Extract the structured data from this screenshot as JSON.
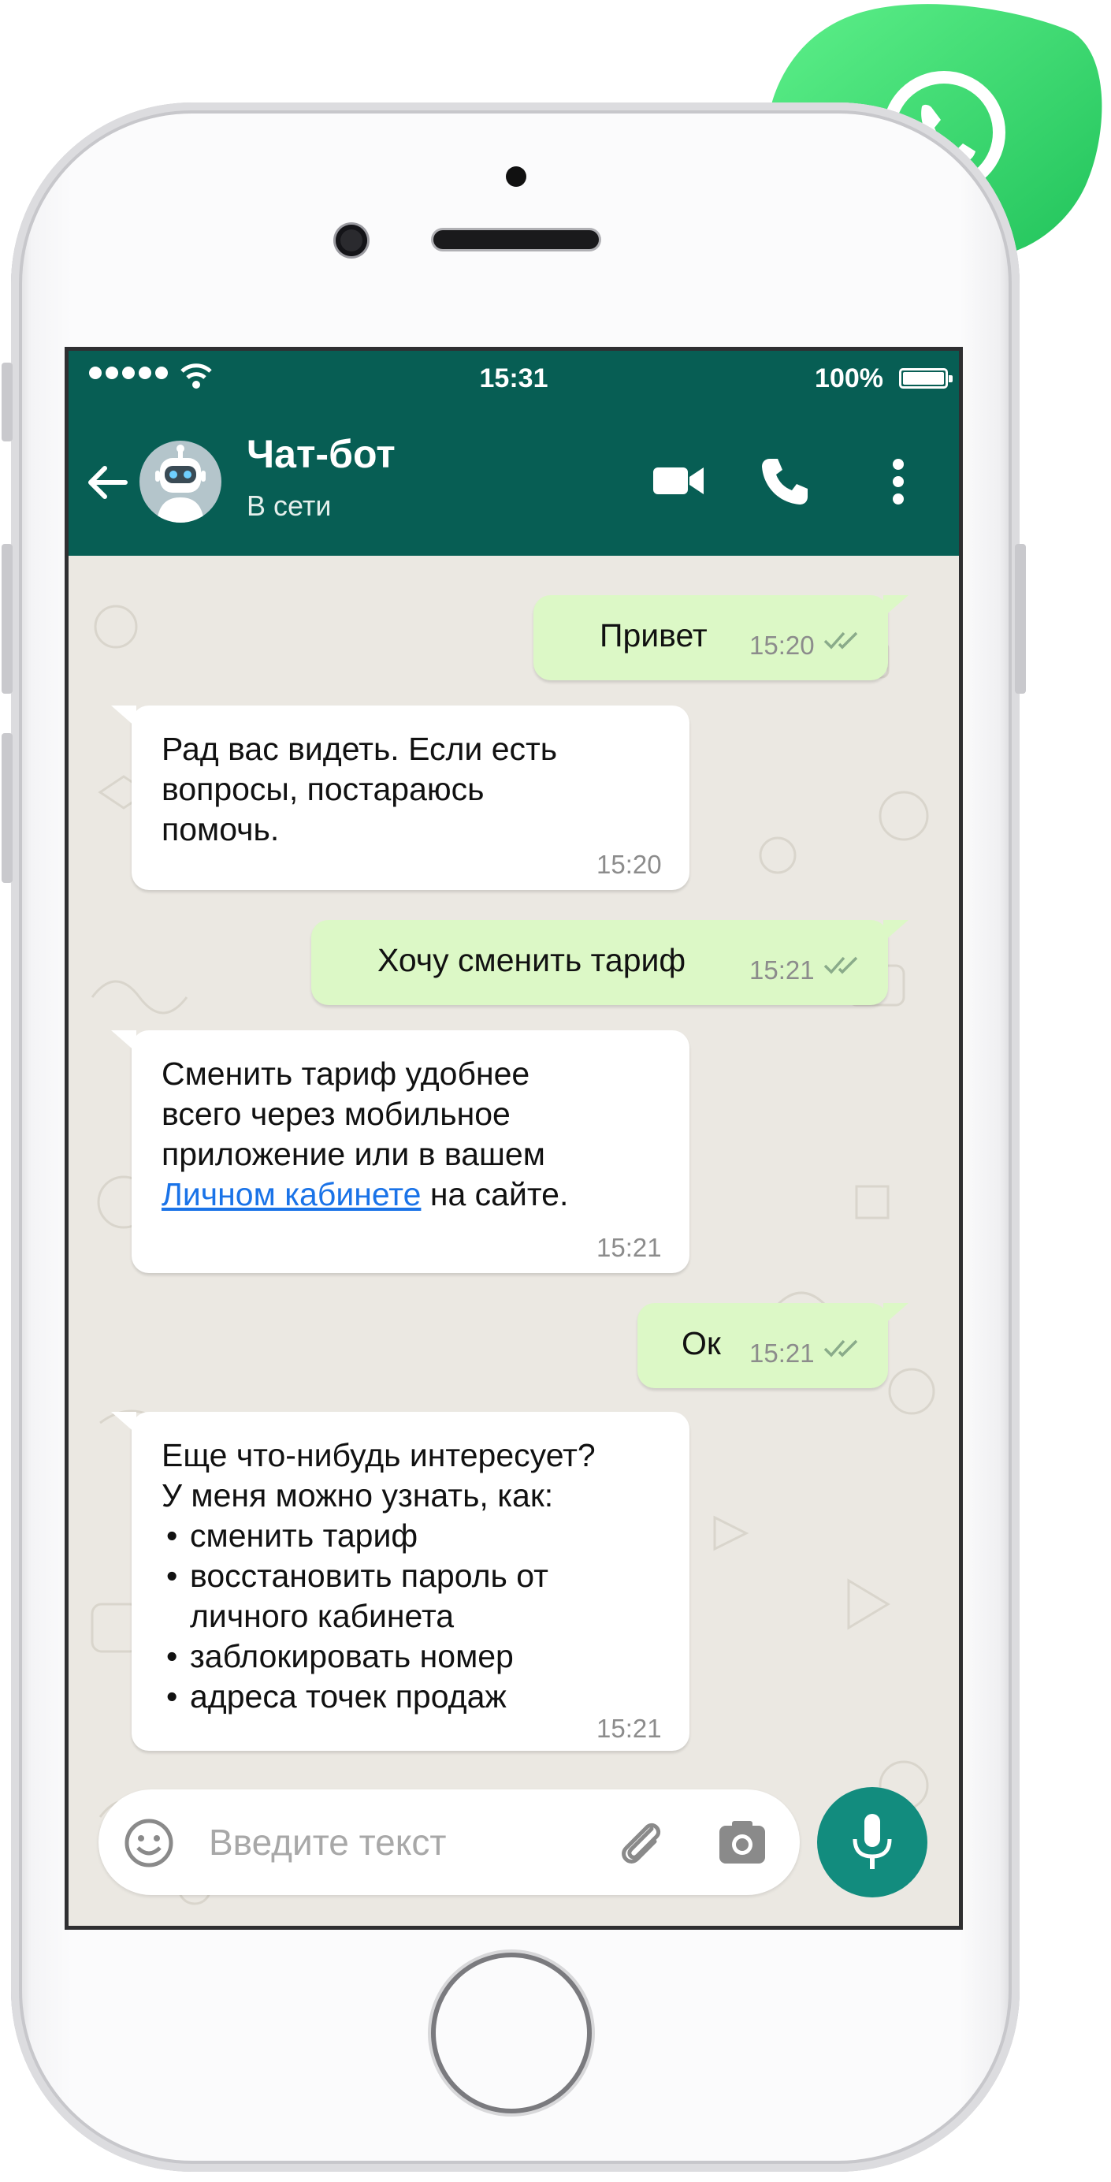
{
  "status_bar": {
    "time": "15:31",
    "battery": "100%"
  },
  "header": {
    "title": "Чат-бот",
    "status": "В сети"
  },
  "messages": [
    {
      "dir": "out",
      "text": "Привет",
      "time": "15:20"
    },
    {
      "dir": "in",
      "lines": [
        "Рад вас видеть. Если есть",
        "вопросы, постараюсь",
        "помочь."
      ],
      "time": "15:20"
    },
    {
      "dir": "out",
      "text": "Хочу сменить тариф",
      "time": "15:21"
    },
    {
      "dir": "in",
      "lines": [
        "Сменить тариф удобнее",
        "всего через мобильное",
        "приложение или в вашем"
      ],
      "link": "Личном кабинете",
      "link_suffix": " на сайте.",
      "time": "15:21"
    },
    {
      "dir": "out",
      "text": "Ок",
      "time": "15:21"
    },
    {
      "dir": "in",
      "lines": [
        "Еще что-нибудь интересует?",
        "У меня можно узнать, как:"
      ],
      "bullets": [
        "сменить тариф",
        "восстановить пароль от",
        "личного кабинета",
        "заблокировать номер",
        "адреса точек продаж"
      ],
      "time": "15:21"
    }
  ],
  "input": {
    "placeholder": "Введите текст"
  },
  "icons": {
    "back": "arrow-left-icon",
    "video": "video-camera-icon",
    "call": "phone-icon",
    "menu": "more-vert-icon",
    "emoji": "smiley-icon",
    "attach": "paperclip-icon",
    "camera": "camera-icon",
    "mic": "microphone-icon",
    "logo": "whatsapp-icon"
  },
  "colors": {
    "header": "#075e54",
    "outgoing": "#dcf8c6",
    "incoming": "#ffffff",
    "mic": "#128c7e",
    "link": "#1a73e8",
    "brand": "#25d366"
  }
}
